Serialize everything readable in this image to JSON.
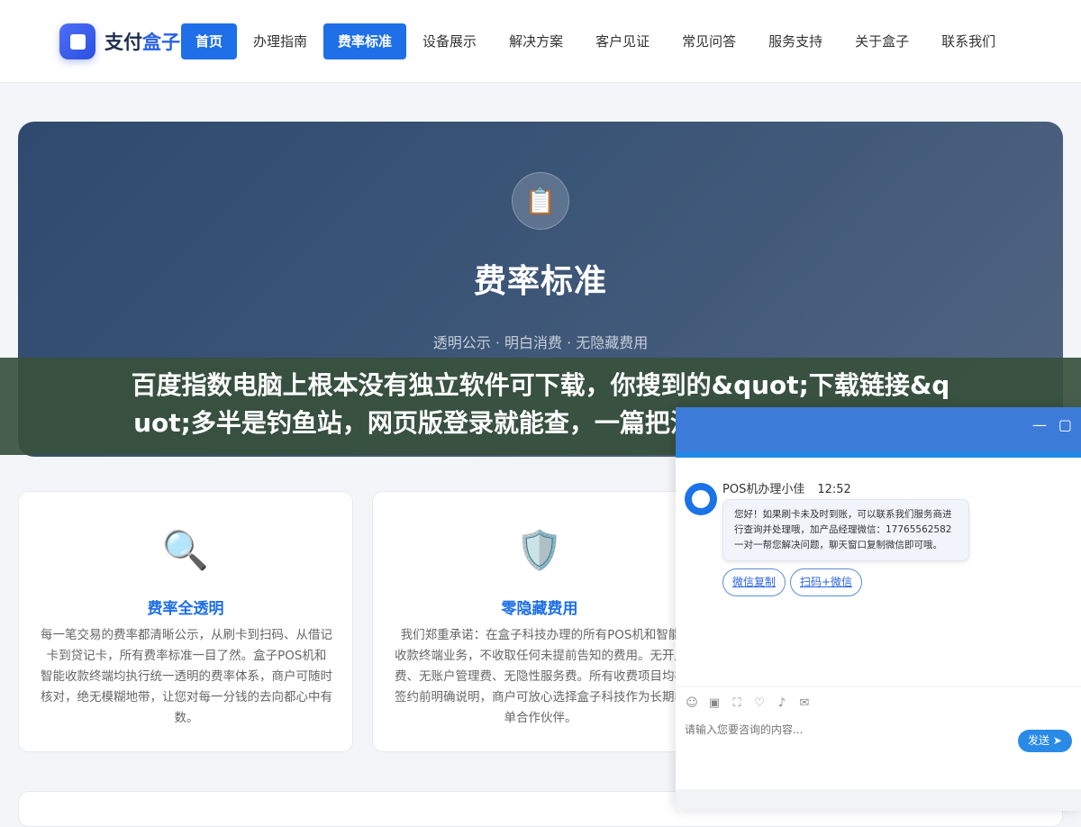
{
  "header": {
    "logo_main": "支付",
    "logo_accent": "盒子",
    "nav": [
      {
        "label": "首页",
        "active": true
      },
      {
        "label": "办理指南",
        "active": false
      },
      {
        "label": "费率标准",
        "active": true
      },
      {
        "label": "设备展示",
        "active": false
      },
      {
        "label": "解决方案",
        "active": false
      },
      {
        "label": "客户见证",
        "active": false
      },
      {
        "label": "常见问答",
        "active": false
      },
      {
        "label": "服务支持",
        "active": false
      },
      {
        "label": "关于盒子",
        "active": false
      },
      {
        "label": "联系我们",
        "active": false
      }
    ]
  },
  "hero": {
    "icon": "clipboard-icon",
    "title": "费率标准",
    "subtitle": "透明公示 · 明白消费 · 无隐藏费用"
  },
  "banner": {
    "line1": "百度指数电脑上根本没有独立软件可下载，你搜到的&quot;下载链接&q",
    "line2": "uot;多半是钓鱼站，网页版登录就能查，一篇把注册、使用和这几个坑讲"
  },
  "cards": [
    {
      "icon": "magnifier-icon",
      "title": "费率全透明",
      "text": "每一笔交易的费率都清晰公示，从刷卡到扫码、从借记卡到贷记卡，所有费率标准一目了然。盒子POS机和智能收款终端均执行统一透明的费率体系，商户可随时核对，绝无模糊地带，让您对每一分钱的去向都心中有数。"
    },
    {
      "icon": "shield-icon",
      "title": "零隐藏费用",
      "text": "我们郑重承诺：在盒子科技办理的所有POS机和智能收款终端业务，不收取任何未提前告知的费用。无开户费、无账户管理费、无隐性服务费。所有收费项目均在签约前明确说明，商户可放心选择盒子科技作为长期收单合作伙伴。"
    }
  ],
  "chat": {
    "agent_name": "POS机办理小佳",
    "time": "12:52",
    "message": "您好！如果刷卡未及时到账，可以联系我们服务商进行查询并处理哦，加产品经理微信：17765562582 一对一帮您解决问题，聊天窗口复制微信即可哦。",
    "quick_replies": [
      "微信复制",
      "扫码+微信"
    ],
    "input_placeholder": "请输入您要咨询的内容...",
    "send_label": "发送",
    "minimize": "—",
    "close": "▢"
  }
}
